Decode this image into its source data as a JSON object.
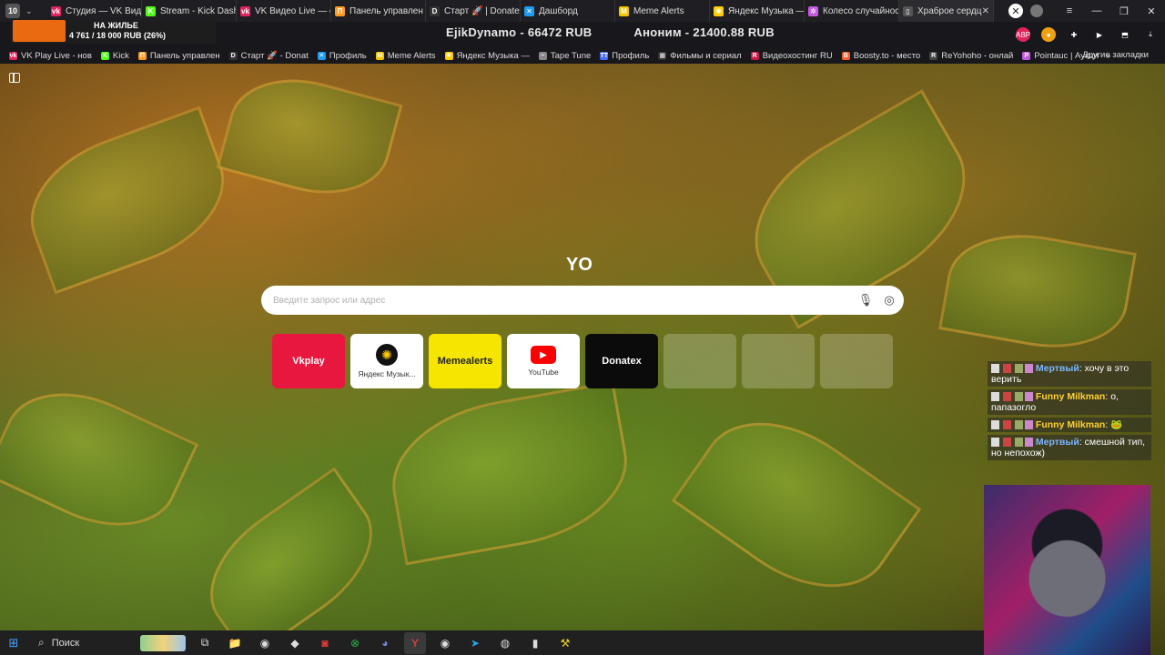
{
  "browser": {
    "tab_count": "10",
    "tabs": [
      {
        "label": "Студия — VK Вид",
        "icon": "vk-video-icon",
        "color": "#e0245e",
        "favtext": "vk"
      },
      {
        "label": "Stream - Kick Dash",
        "icon": "kick-icon",
        "color": "#53fc18",
        "favtext": "K"
      },
      {
        "label": "VK Видео Live — с",
        "icon": "vk-video-icon",
        "color": "#e0245e",
        "favtext": "vk"
      },
      {
        "label": "Панель управлен",
        "icon": "page-icon",
        "color": "#ff9a1f",
        "favtext": "П"
      },
      {
        "label": "Старт 🚀 | Donate",
        "icon": "donatex-icon",
        "color": "#333333",
        "favtext": "D"
      },
      {
        "label": "Дашборд",
        "icon": "x-logo-icon",
        "color": "#1d9bf0",
        "favtext": "✕"
      },
      {
        "label": "Meme Alerts",
        "icon": "memealerts-icon",
        "color": "#f5c400",
        "favtext": "M"
      },
      {
        "label": "Яндекс Музыка —",
        "icon": "yandex-music-icon",
        "color": "#ffcc00",
        "favtext": "✺"
      },
      {
        "label": "Колесо случайнос",
        "icon": "wheel-icon",
        "color": "#c25be0",
        "favtext": "✲"
      },
      {
        "label": "Храброе сердц",
        "icon": "page-icon",
        "color": "#555555",
        "favtext": "▯",
        "active": true
      }
    ],
    "window_controls": [
      "≡",
      "—",
      "❐",
      "✕"
    ]
  },
  "stream_overlay": {
    "goal_title": "НА ЖИЛЬЕ",
    "goal_progress": "4 761 / 18 000 RUB (26%)",
    "goal_fraction": 0.26,
    "donors": [
      "EjikDynamo - 66472 RUB",
      "Аноним - 21400.88 RUB"
    ]
  },
  "bookmarks": [
    {
      "label": "VK Play Live - нов",
      "color": "#e0245e",
      "fav": "vk"
    },
    {
      "label": "Kick",
      "color": "#53fc18",
      "fav": "K"
    },
    {
      "label": "Панель управлен",
      "color": "#ff9a1f",
      "fav": "П"
    },
    {
      "label": "Старт 🚀 - Donat",
      "color": "#333333",
      "fav": "D"
    },
    {
      "label": "Профиль",
      "color": "#1d9bf0",
      "fav": "✕"
    },
    {
      "label": "Meme Alerts",
      "color": "#f5c400",
      "fav": "M"
    },
    {
      "label": "Яндекс Музыка —",
      "color": "#ffcc00",
      "fav": "✺"
    },
    {
      "label": "Tape Tune",
      "color": "#888888",
      "fav": "~"
    },
    {
      "label": "Профиль",
      "color": "#4a6cf7",
      "fav": "TT"
    },
    {
      "label": "Фильмы и сериал",
      "color": "#333333",
      "fav": "▦"
    },
    {
      "label": "Видеохостинг RU",
      "color": "#c41a4a",
      "fav": "R"
    },
    {
      "label": "Boosty.to - место",
      "color": "#f15f2c",
      "fav": "B"
    },
    {
      "label": "ReYohoho - онлай",
      "color": "#444444",
      "fav": "R"
    },
    {
      "label": "Pointauc | Аукци",
      "color": "#c25be0",
      "fav": "P"
    }
  ],
  "bookmarks_other": "Другие закладки",
  "search": {
    "logo": "YO",
    "placeholder": "Введите запрос или адрес"
  },
  "tiles": [
    {
      "label": "Vkplay",
      "bg": "#e8173f",
      "fg": "#ffffff"
    },
    {
      "label": "Яндекс Музык...",
      "bg": "#ffffff",
      "fg": "#222222",
      "icon": "yandex-music-icon"
    },
    {
      "label": "Memealerts",
      "bg": "#f6e500",
      "fg": "#222222"
    },
    {
      "label": "YouTube",
      "bg": "#ffffff",
      "fg": "#222222",
      "icon": "youtube-icon"
    },
    {
      "label": "Donatex",
      "bg": "#0b0b0b",
      "fg": "#ffffff"
    }
  ],
  "chat": [
    {
      "user": "Мертвый",
      "text": "хочу в это верить",
      "cls": "u1"
    },
    {
      "user": "Funny Milkman",
      "text": "о, папазогло",
      "cls": "u2"
    },
    {
      "user": "Funny Milkman",
      "text": "",
      "cls": "u2"
    },
    {
      "user": "Мертвый",
      "text": "смешной тип, но непохож)",
      "cls": "u1"
    }
  ],
  "taskbar": {
    "search_label": "Поиск",
    "icons": [
      "task-view-icon",
      "explorer-icon",
      "steam-icon",
      "app-icon",
      "yandex-music-icon",
      "xbox-icon",
      "discord-icon",
      "yandex-browser-icon",
      "steam-icon",
      "telegram-icon",
      "obs-icon",
      "terminal-icon",
      "tool-icon"
    ]
  }
}
